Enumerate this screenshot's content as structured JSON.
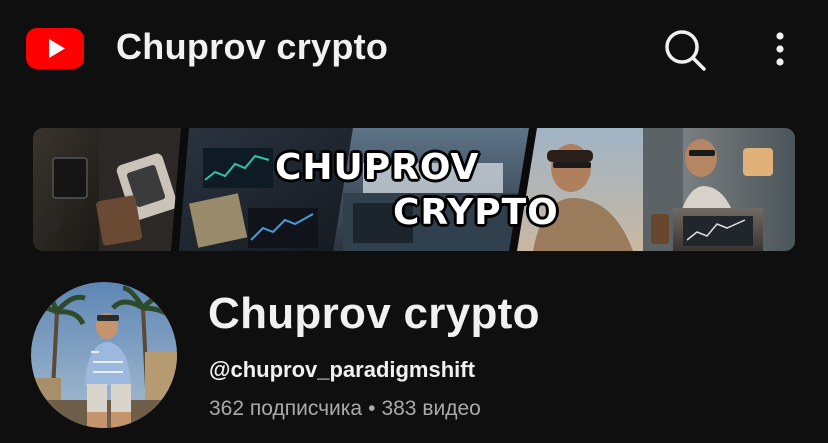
{
  "header": {
    "title": "Chuprov crypto",
    "logo_icon": "youtube-logo-icon",
    "search_icon": "search-icon",
    "more_icon": "more-vertical-icon"
  },
  "banner": {
    "line1": "CHUPROV",
    "line2": "CRYPTO"
  },
  "channel": {
    "name": "Chuprov crypto",
    "handle": "@chuprov_paradigmshift",
    "subscribers": "362 подписчика",
    "separator": "•",
    "videos": "383 видео"
  },
  "colors": {
    "background": "#0f0f0f",
    "brand_red": "#ff0000",
    "text_primary": "#f1f1f1",
    "text_secondary": "#aaaaaa"
  }
}
